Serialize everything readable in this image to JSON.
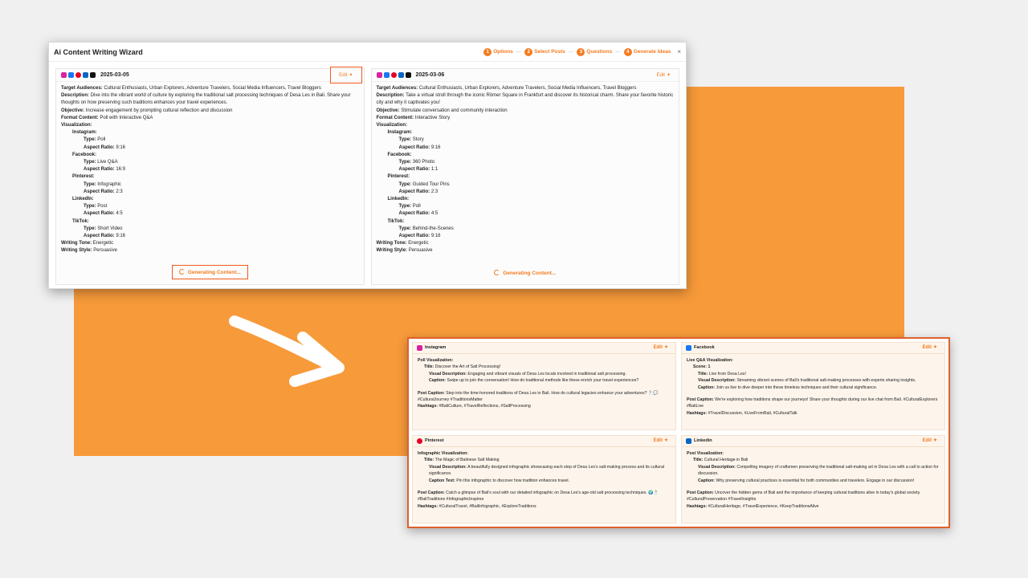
{
  "wizard": {
    "title": "Ai Content Writing Wizard",
    "steps": [
      {
        "num": "1",
        "label": "Options"
      },
      {
        "num": "2",
        "label": "Select Posts"
      },
      {
        "num": "3",
        "label": "Questions"
      },
      {
        "num": "4",
        "label": "Generate Ideas"
      }
    ],
    "close": "×",
    "edit_label": "Edit",
    "generating_label": "Generating Content...",
    "columns": [
      {
        "date": "2025-03-05",
        "target_label": "Target Audiences:",
        "target": "Cultural Enthusiasts, Urban Explorers, Adventure Travelers, Social Media Influencers, Travel Bloggers",
        "desc_label": "Description:",
        "desc": "Dive into the vibrant world of culture by exploring the traditional salt processing techniques of Desa Les in Bali. Share your thoughts on how preserving such traditions enhances your travel experiences.",
        "objective_label": "Objective:",
        "objective": "Increase engagement by prompting cultural reflection and discussion",
        "format_label": "Format Content:",
        "format": "Poll with Interactive Q&A",
        "vis_label": "Visualization:",
        "platforms": [
          {
            "name": "Instagram:",
            "type": "Poll",
            "ratio": "9:16"
          },
          {
            "name": "Facebook:",
            "type": "Live Q&A",
            "ratio": "16:9"
          },
          {
            "name": "Pinterest:",
            "type": "Infographic",
            "ratio": "2:3"
          },
          {
            "name": "LinkedIn:",
            "type": "Post",
            "ratio": "4:5"
          },
          {
            "name": "TikTok:",
            "type": "Short Video",
            "ratio": "9:16"
          }
        ],
        "tone_label": "Writing Tone:",
        "tone": "Energetic",
        "style_label": "Writing Style:",
        "style": "Persuasive"
      },
      {
        "date": "2025-03-06",
        "target_label": "Target Audiences:",
        "target": "Cultural Enthusiasts, Urban Explorers, Adventure Travelers, Social Media Influencers, Travel Bloggers",
        "desc_label": "Description:",
        "desc": "Take a virtual stroll through the iconic Römer Square in Frankfurt and discover its historical charm. Share your favorite historic city and why it captivates you!",
        "objective_label": "Objective:",
        "objective": "Stimulate conversation and community interaction",
        "format_label": "Format Content:",
        "format": "Interactive Story",
        "vis_label": "Visualization:",
        "platforms": [
          {
            "name": "Instagram:",
            "type": "Story",
            "ratio": "9:16"
          },
          {
            "name": "Facebook:",
            "type": "360 Photo",
            "ratio": "1:1"
          },
          {
            "name": "Pinterest:",
            "type": "Guided Tour Pins",
            "ratio": "2:3"
          },
          {
            "name": "LinkedIn:",
            "type": "Poll",
            "ratio": "4:5"
          },
          {
            "name": "TikTok:",
            "type": "Behind-the-Scenes",
            "ratio": "9:16"
          }
        ],
        "tone_label": "Writing Tone:",
        "tone": "Energetic",
        "style_label": "Writing Style:",
        "style": "Persuasive"
      }
    ],
    "type_label": "Type:",
    "ratio_label": "Aspect Ratio:"
  },
  "results": {
    "edit_label": "Edit",
    "cards": [
      {
        "name": "Instagram",
        "vis_title": "Poll Visualization:",
        "scene": "",
        "title_label": "Title:",
        "title": "Discover the Art of Salt Processing!",
        "vd_label": "Visual Description:",
        "vd": "Engaging and vibrant visuals of Desa Les locals involved in traditional salt processing.",
        "cap_label": "Caption:",
        "cap": "Swipe up to join the conversation! How do traditional methods like these enrich your travel experiences?",
        "post_label": "Post Caption:",
        "post": "Step into the time-honored traditions of Desa Les in Bali. How do cultural legacies enhance your adventures? 🧂💬 #CulturalJourney #TraditionsMatter",
        "hash_label": "Hashtags:",
        "hash": "#BaliCulture, #TravelReflections, #SaltProcessing"
      },
      {
        "name": "Facebook",
        "vis_title": "Live Q&A Visualization:",
        "scene": "Scene: 1",
        "title_label": "Title:",
        "title": "Live from Desa Les!",
        "vd_label": "Visual Description:",
        "vd": "Streaming vibrant scenes of Bali's traditional salt-making processes with experts sharing insights.",
        "cap_label": "Caption:",
        "cap": "Join us live to dive deeper into these timeless techniques and their cultural significance.",
        "post_label": "Post Caption:",
        "post": "We're exploring how traditions shape our journeys! Share your thoughts during our live chat from Bali. #CulturalExplorers #BaliLive",
        "hash_label": "Hashtags:",
        "hash": "#TravelDiscussion, #LiveFromBali, #CulturalTalk"
      },
      {
        "name": "Pinterest",
        "vis_title": "Infographic Visualization:",
        "scene": "",
        "title_label": "Title:",
        "title": "The Magic of Balinese Salt Making",
        "vd_label": "Visual Description:",
        "vd": "A beautifully designed infographic showcasing each step of Desa Les's salt-making process and its cultural significance.",
        "cap_label": "Caption Text:",
        "cap": "Pin this infographic to discover how tradition enhances travel.",
        "post_label": "Post Caption:",
        "post": "Catch a glimpse of Bali's soul with our detailed infographic on Desa Les's age-old salt processing techniques. 🌍🧂 #BaliTraditions #InfographicInspires",
        "hash_label": "Hashtags:",
        "hash": "#CulturalTravel, #BaliInfographic, #ExploreTraditions"
      },
      {
        "name": "Linkedin",
        "vis_title": "Post Visualization:",
        "scene": "",
        "title_label": "Title:",
        "title": "Cultural Heritage in Bali",
        "vd_label": "Visual Description:",
        "vd": "Compelling imagery of craftsmen preserving the traditional salt-making art in Desa Les with a call to action for discussion.",
        "cap_label": "Caption:",
        "cap": "Why preserving cultural practices is essential for both communities and travelers. Engage in our discussion!",
        "post_label": "Post Caption:",
        "post": "Uncover the hidden gems of Bali and the importance of keeping cultural traditions alive in today's global society. #CulturalPreservation #TravelInsights",
        "hash_label": "Hashtags:",
        "hash": "#CulturalHeritage, #TravelExperience, #KeepTraditionsAlive"
      }
    ]
  },
  "colors": {
    "accent": "#f47b20",
    "background_block": "#f79a3a",
    "highlight": "#f25a1a",
    "card_bg": "#fdf5ec"
  },
  "icons": [
    "instagram-icon",
    "facebook-icon",
    "pinterest-icon",
    "linkedin-icon",
    "tiktok-icon",
    "sparkle-icon",
    "spinner-icon",
    "arrow-icon"
  ]
}
